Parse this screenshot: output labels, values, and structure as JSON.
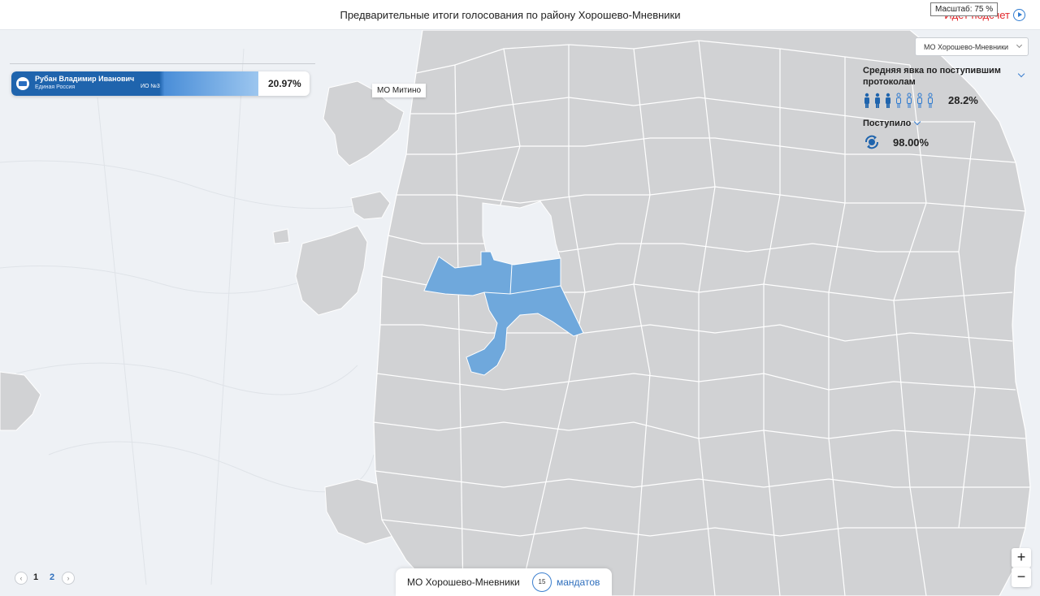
{
  "header": {
    "title": "Предварительные итоги голосования по району Хорошево-Мневники",
    "live_label": "Идет подсчет",
    "scale_tooltip": "Масштаб: 75 %"
  },
  "map": {
    "label_mitino": "МО Митино",
    "land_color": "#d1d2d4",
    "highlight_color": "#6fa8dc"
  },
  "candidate": {
    "name": "Рубан Владимир Иванович",
    "party": "Единая Россия",
    "district": "ИО №3",
    "percent": "20.97%",
    "bar_color": "#1f64ad"
  },
  "district_select": {
    "value": "МО Хорошево-Мневники"
  },
  "stats": {
    "turnout_label": "Средняя явка по поступившим протоколам",
    "turnout_value": "28.2%",
    "turnout_fraction": 0.282,
    "received_label": "Поступило",
    "received_value": "98.00%"
  },
  "pager": {
    "pages": [
      "1",
      "2"
    ]
  },
  "bottom_bar": {
    "district": "МО Хорошево-Мневники",
    "mandates_count": "15",
    "mandates_label": "мандатов"
  },
  "zoom": {
    "in": "+",
    "out": "−"
  }
}
